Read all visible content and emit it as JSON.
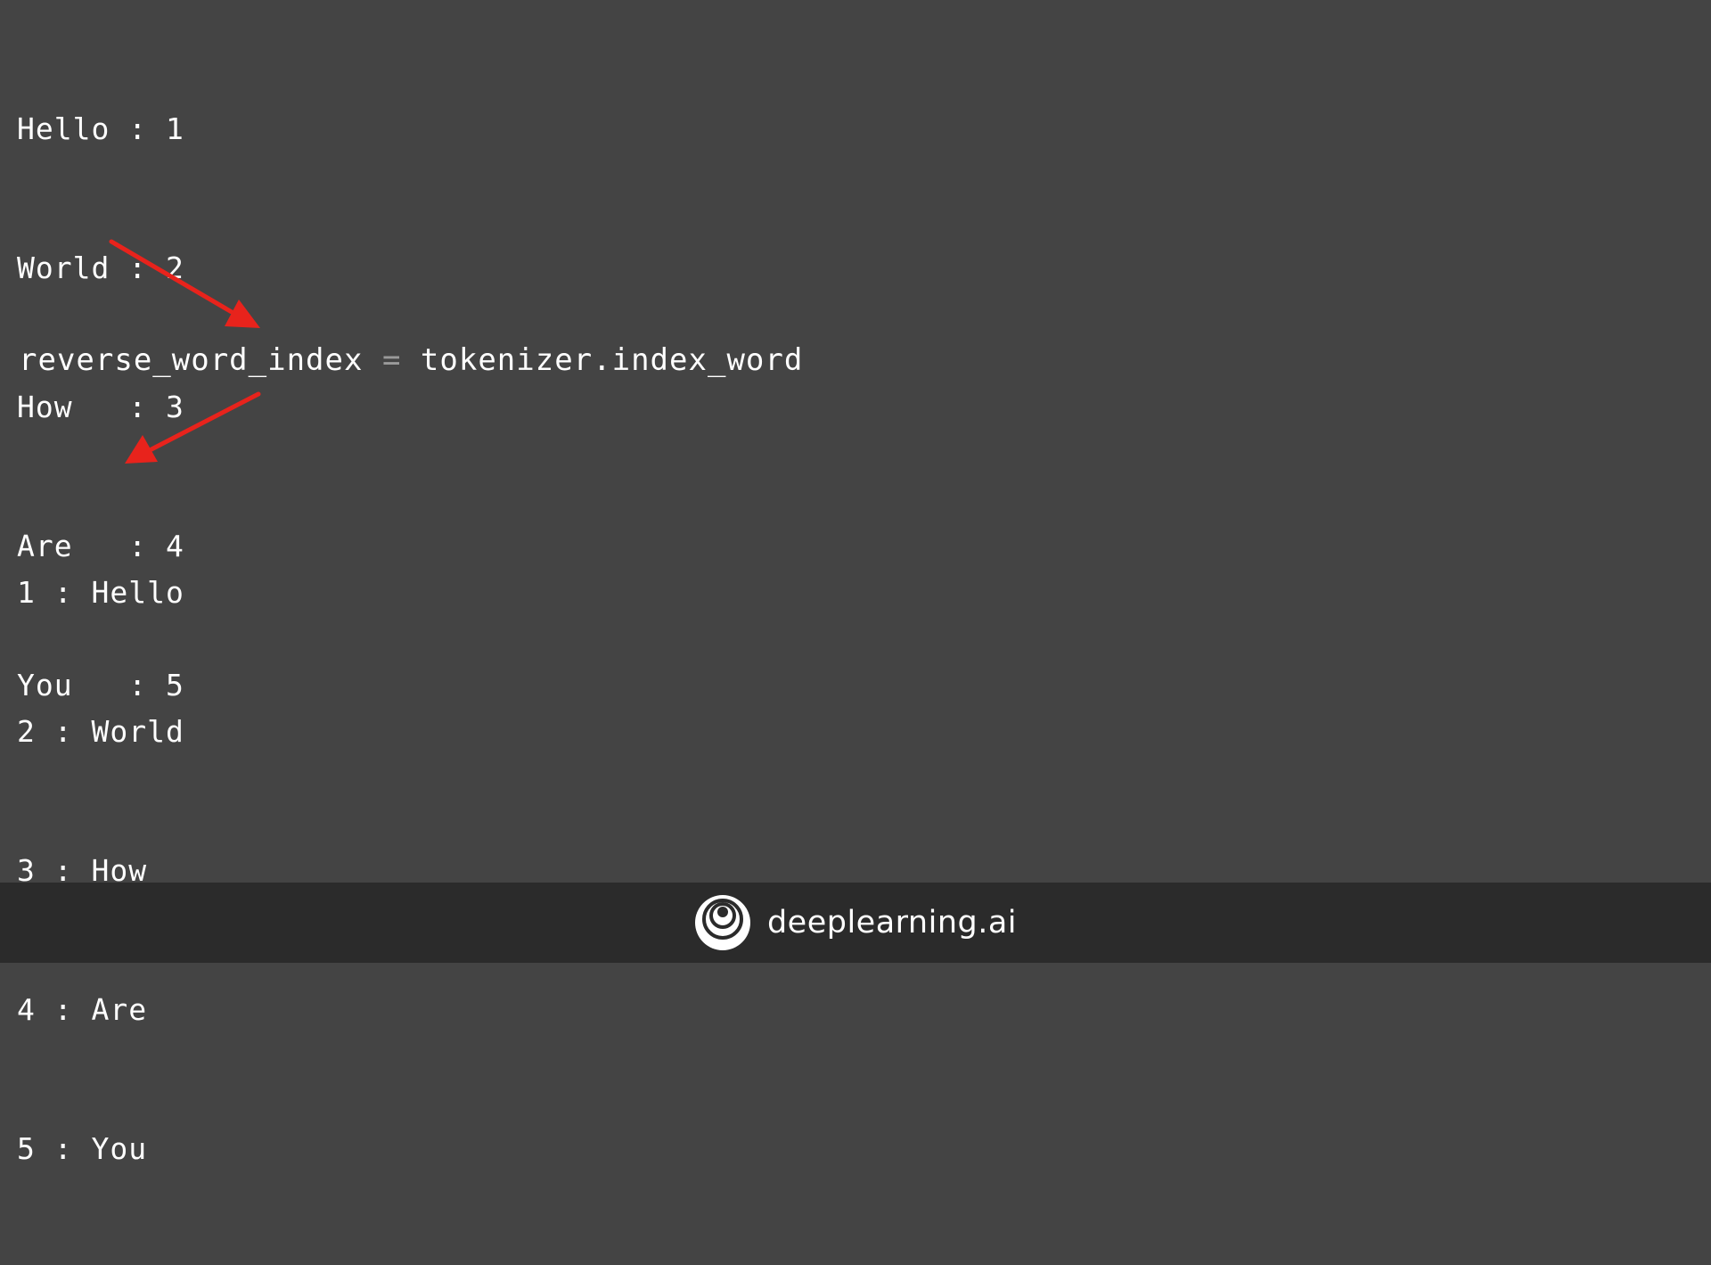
{
  "word_index": [
    {
      "word": "Hello",
      "sep": " : ",
      "index": "1"
    },
    {
      "word": "World",
      "sep": " : ",
      "index": "2"
    },
    {
      "word": "How  ",
      "sep": " : ",
      "index": "3"
    },
    {
      "word": "Are  ",
      "sep": " : ",
      "index": "4"
    },
    {
      "word": "You  ",
      "sep": " : ",
      "index": "5"
    }
  ],
  "code": {
    "lhs": "reverse_word_index",
    "operator": "=",
    "rhs": "tokenizer.index_word"
  },
  "index_word": [
    {
      "index": "1",
      "sep": " : ",
      "word": "Hello"
    },
    {
      "index": "2",
      "sep": " : ",
      "word": "World"
    },
    {
      "index": "3",
      "sep": " : ",
      "word": "How"
    },
    {
      "index": "4",
      "sep": " : ",
      "word": "Are"
    },
    {
      "index": "5",
      "sep": " : ",
      "word": "You"
    }
  ],
  "footer": {
    "brand_name": "deeplearning.ai",
    "logo_icon": "deeplearning-logo-icon"
  },
  "colors": {
    "background": "#444444",
    "footer": "#2b2b2b",
    "text": "#ffffff",
    "arrow": "#e8231c",
    "operator": "#9a9a9a"
  }
}
